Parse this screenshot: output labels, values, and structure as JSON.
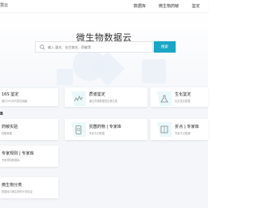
{
  "header": {
    "brand": "慧云",
    "nav": [
      "数据库",
      "微生物药敏",
      "鉴定"
    ]
  },
  "hero": {
    "title": "微生物数据云",
    "search_placeholder": "输入 菌名、抗生物名、药敏等",
    "search_button": "搜索"
  },
  "sections": {
    "label_b": "B"
  },
  "cards": [
    {
      "title": "16S 鉴定",
      "desc": "通过16S序列鉴定细菌",
      "icon": "dna-icon"
    },
    {
      "title": "质谱鉴定",
      "desc": "通过质谱数据鉴定微生物",
      "icon": "spectrum-icon"
    },
    {
      "title": "生化鉴定",
      "desc": "生化鉴定数据",
      "icon": "flask-icon"
    },
    {
      "title": "药敏实验",
      "desc": "药敏数据",
      "icon": "pill-icon"
    },
    {
      "title": "抗菌药物 | 专家库",
      "desc": "专家共识数据",
      "icon": "phone-icon"
    },
    {
      "title": "折点 | 专家库",
      "desc": "专家共识数据",
      "icon": "book-icon"
    },
    {
      "title": "专家规则 | 专家库",
      "desc": "专家规则数据库",
      "icon": "rule-icon"
    },
    {
      "title": "微生物分类",
      "desc": "数据库中微生物的分类信息",
      "icon": "tree-icon"
    }
  ]
}
